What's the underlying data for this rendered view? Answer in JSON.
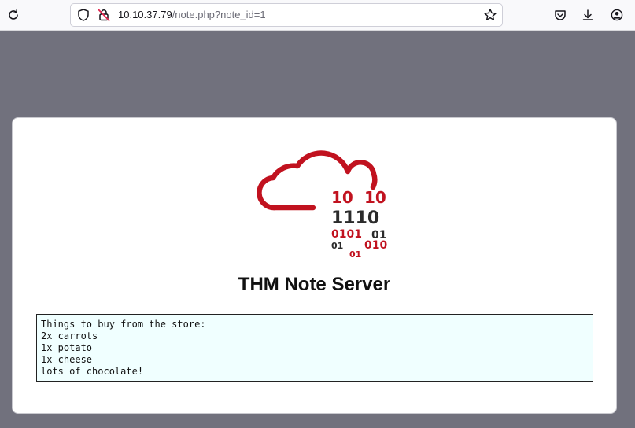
{
  "browser": {
    "url_host": "10.10.37.79",
    "url_path": "/note.php?note_id=1"
  },
  "page": {
    "logo_bits": {
      "row1_left": "10",
      "row1_right": "10",
      "row2": "1110",
      "row3_left": "0101",
      "row3_right": "01",
      "row4_left": "01",
      "row4_right": "010",
      "row5": "01"
    },
    "title": "THM Note Server",
    "note_lines": [
      "Things to buy from the store:",
      "2x carrots",
      "1x potato",
      "1x cheese",
      "lots of chocolate!"
    ]
  },
  "colors": {
    "brand_red": "#c1121f",
    "dark_text": "#2b2b2b"
  }
}
